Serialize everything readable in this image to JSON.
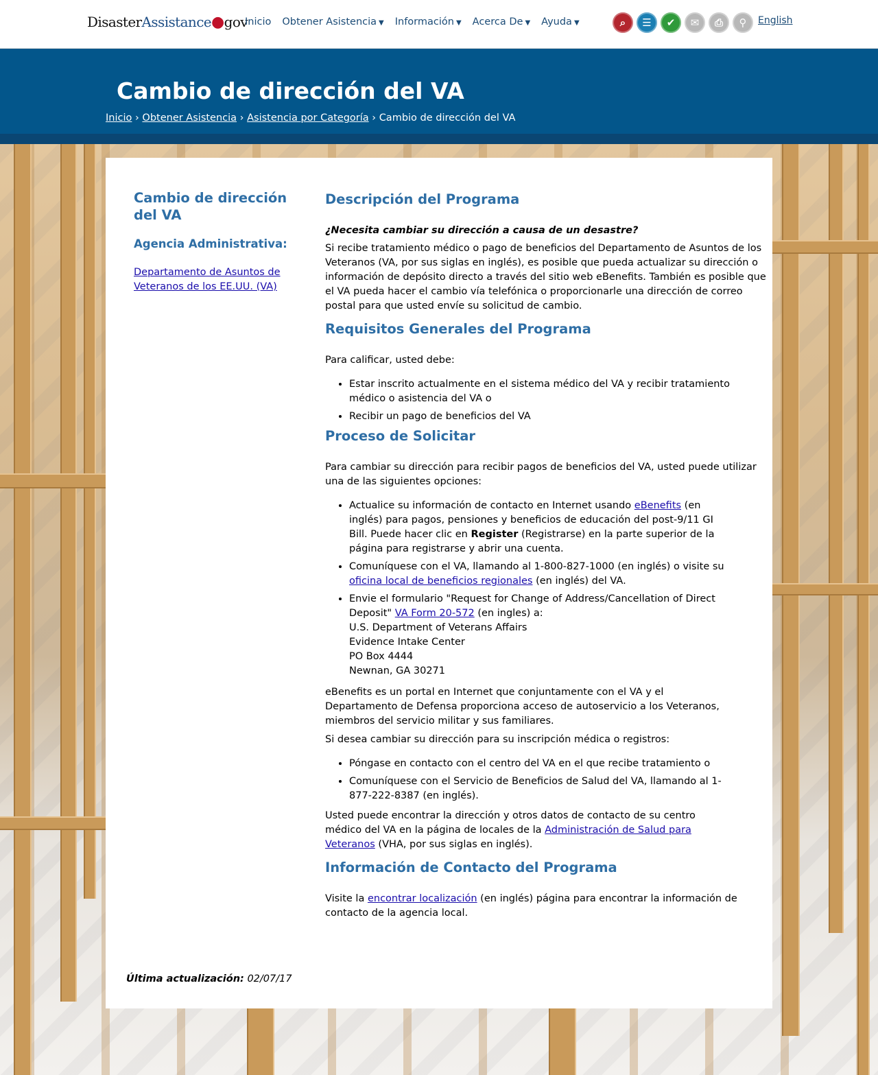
{
  "logo": {
    "part1": "Disaster",
    "part2": "Assistance",
    "dot": "●",
    "part3": "gov"
  },
  "nav": {
    "items": [
      {
        "label": "Inicio",
        "dropdown": false
      },
      {
        "label": "Obtener Asistencia",
        "dropdown": true
      },
      {
        "label": "Información",
        "dropdown": true
      },
      {
        "label": "Acerca De",
        "dropdown": true
      },
      {
        "label": "Ayuda",
        "dropdown": true
      }
    ],
    "language_link": "English"
  },
  "toolbar_icons": [
    {
      "name": "search-document-icon",
      "glyph": "⌕",
      "color": "#b3262e"
    },
    {
      "name": "checklist-icon",
      "glyph": "☰",
      "color": "#1b7fb3"
    },
    {
      "name": "checkmark-icon",
      "glyph": "✔",
      "color": "#2f9a3a"
    },
    {
      "name": "email-icon",
      "glyph": "✉",
      "color": "#b8b8b8"
    },
    {
      "name": "print-icon",
      "glyph": "⎙",
      "color": "#b8b8b8"
    },
    {
      "name": "search-icon",
      "glyph": "⚲",
      "color": "#b8b8b8"
    }
  ],
  "header": {
    "title": "Cambio de dirección del VA",
    "breadcrumb": [
      {
        "label": "Inicio",
        "link": true
      },
      {
        "label": "Obtener Asistencia",
        "link": true
      },
      {
        "label": "Asistencia por Categoría",
        "link": true
      },
      {
        "label": "Cambio de dirección del VA",
        "link": false
      }
    ],
    "separator": "›"
  },
  "sidebar": {
    "title": "Cambio de dirección del VA",
    "agency_label": "Agencia Administrativa:",
    "agency_link": "Departamento de Asuntos de Veteranos de los EE.UU. (VA)"
  },
  "main": {
    "desc_heading": "Descripción del Programa",
    "desc_question": "¿Necesita cambiar su dirección a causa de un desastre?",
    "desc_text": "Si recibe tratamiento médico o pago de beneficios del Departamento de Asuntos de los Veteranos (VA, por sus siglas en inglés), es posible que pueda actualizar su dirección o información de depósito directo a través del sitio web eBenefits. También es posible que el VA pueda hacer el cambio vía telefónica o proporcionarle una dirección de correo postal para que usted envíe su solicitud de cambio.",
    "req_heading": "Requisitos Generales del Programa",
    "req_intro": "Para calificar, usted debe:",
    "req_items": [
      "Estar inscrito actualmente en el sistema médico del VA y recibir tratamiento médico o asistencia del VA o",
      "Recibir un pago de beneficios del VA"
    ],
    "proc_heading": "Proceso de Solicitar",
    "proc_intro": "Para cambiar su dirección para recibir pagos de beneficios del VA, usted puede utilizar una de las siguientes opciones:",
    "proc_item1": {
      "a": "Actualice su información de contacto en Internet usando ",
      "link": "eBenefits",
      "b": " (en inglés) para pagos, pensiones y beneficios de educación del post-9/11 GI Bill. Puede hacer clic en ",
      "bold": "Register",
      "c": " (Registrarse) en la parte superior de la página para registrarse y abrir una cuenta."
    },
    "proc_item2": {
      "a": "Comuníquese con el VA, llamando al 1-800-827-1000 (en inglés) o visite su ",
      "link": "oficina local de beneficios regionales",
      "b": " (en inglés) del VA."
    },
    "proc_item3": {
      "a": "Envie el formulario \"Request for Change of Address/Cancellation of Direct Deposit\" ",
      "link": "VA Form 20-572",
      "b": " (en ingles) a:",
      "address": [
        "U.S. Department of Veterans Affairs",
        "Evidence Intake Center",
        "PO Box 4444",
        "Newnan, GA 30271"
      ]
    },
    "ebenefits_text": "eBenefits es un portal en Internet que conjuntamente con el VA y el Departamento de Defensa proporciona acceso de autoservicio a los Veteranos, miembros del servicio militar y sus familiares.",
    "medical_intro": "Si desea cambiar su dirección para su inscripción médica o registros:",
    "medical_items": [
      "Póngase en contacto con el centro del VA en el que recibe tratamiento o",
      "Comuníquese con el Servicio de Beneficios de Salud del VA, llamando al 1-877-222-8387 (en inglés)."
    ],
    "vha_text": {
      "a": "Usted puede encontrar la dirección y otros datos de contacto de su centro médico del VA en la página de locales de la ",
      "link": "Administración de Salud para Veteranos",
      "b": " (VHA, por sus siglas en inglés)."
    },
    "contact_heading": "Información de Contacto del Programa",
    "contact_text": {
      "a": "Visite la ",
      "link": "encontrar localización",
      "b": " (en inglés) página para encontrar la información de contacto de la agencia local."
    }
  },
  "footer": {
    "updated_label": "Última actualización:",
    "updated_value": "02/07/17"
  }
}
